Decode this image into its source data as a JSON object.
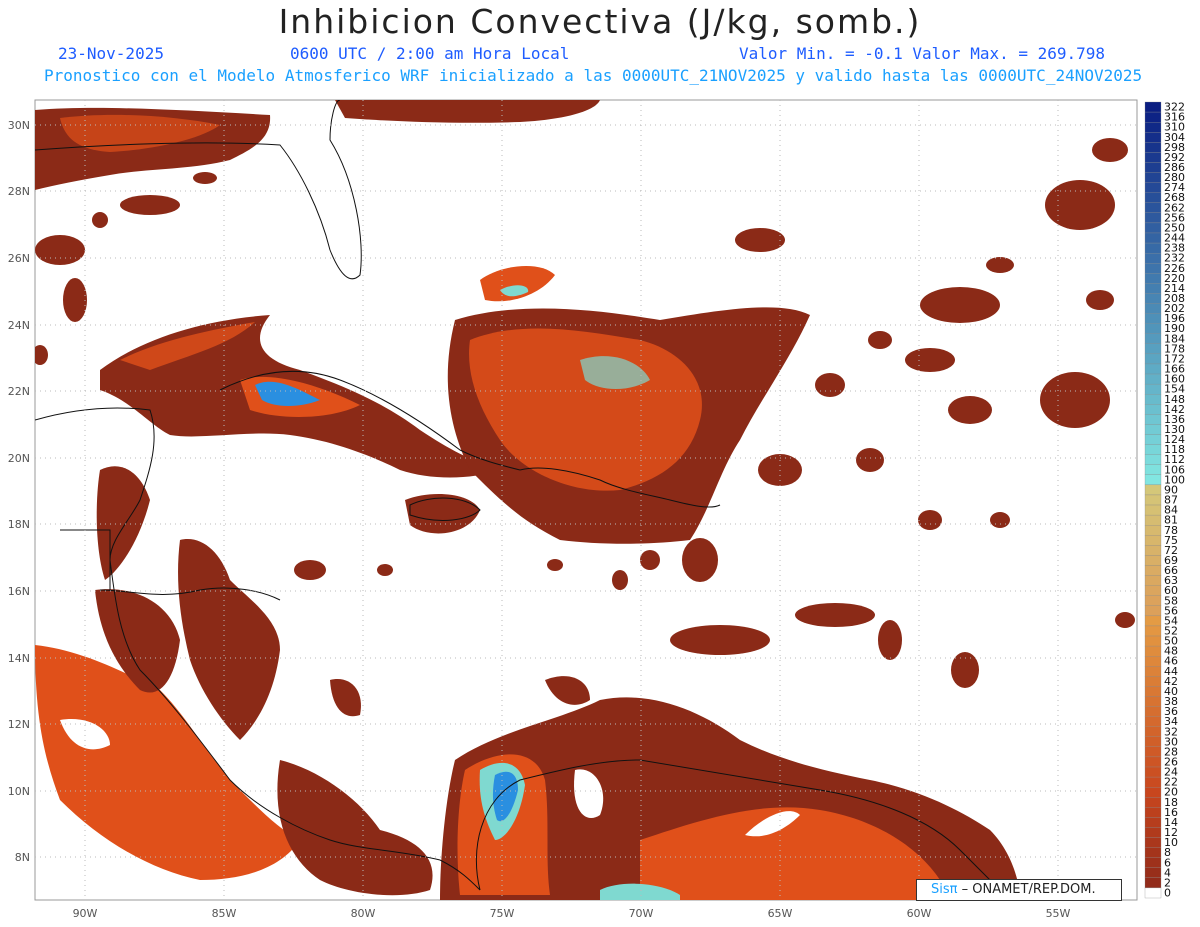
{
  "header": {
    "title": "Inhibicion Convectiva (J/kg, somb.)",
    "date": "23-Nov-2025",
    "time": "0600 UTC / 2:00 am Hora Local",
    "minmax": "Valor Min. = -0.1  Valor Max. = 269.798",
    "forecast": "Pronostico con el Modelo Atmosferico WRF inicializado a las 0000UTC_21NOV2025 y valido hasta las  0000UTC_24NOV2025"
  },
  "axes": {
    "lon_labels": [
      "90W",
      "85W",
      "80W",
      "75W",
      "70W",
      "65W",
      "60W",
      "55W"
    ],
    "lat_labels": [
      "30N",
      "28N",
      "26N",
      "24N",
      "22N",
      "20N",
      "18N",
      "16N",
      "14N",
      "12N",
      "10N",
      "8N"
    ]
  },
  "colorbar": {
    "labels": [
      "322",
      "316",
      "310",
      "304",
      "298",
      "292",
      "286",
      "280",
      "274",
      "268",
      "262",
      "256",
      "250",
      "244",
      "238",
      "232",
      "226",
      "220",
      "214",
      "208",
      "202",
      "196",
      "190",
      "184",
      "178",
      "172",
      "166",
      "160",
      "154",
      "148",
      "142",
      "136",
      "130",
      "124",
      "118",
      "112",
      "106",
      "100",
      "90",
      "87",
      "84",
      "81",
      "78",
      "75",
      "72",
      "69",
      "66",
      "63",
      "60",
      "58",
      "56",
      "54",
      "52",
      "50",
      "48",
      "46",
      "44",
      "42",
      "40",
      "38",
      "36",
      "34",
      "32",
      "30",
      "28",
      "26",
      "24",
      "22",
      "20",
      "18",
      "16",
      "14",
      "12",
      "10",
      "8",
      "6",
      "4",
      "2",
      "0"
    ]
  },
  "credit": {
    "brand": "Sisπ",
    "text": "– ONAMET/REP.DOM."
  },
  "colors": {
    "cin_low": "#8b2a17",
    "cin_mid": "#e0501a",
    "cin_high": "#2a8fe0",
    "accent": "#1e5cff"
  }
}
